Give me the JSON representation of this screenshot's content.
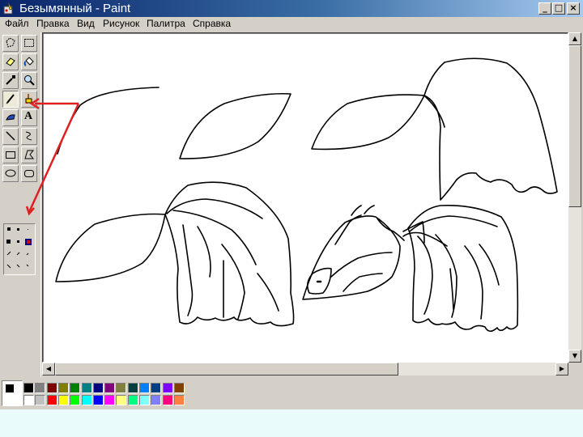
{
  "window": {
    "title": "Безымянный - Paint",
    "controls": {
      "minimize": "_",
      "maximize": "□",
      "close": "×"
    }
  },
  "menu": [
    "Файл",
    "Правка",
    "Вид",
    "Рисунок",
    "Палитра",
    "Справка"
  ],
  "toolbox": {
    "tools": [
      {
        "name": "free-select",
        "icon": "free-select-icon"
      },
      {
        "name": "rect-select",
        "icon": "rect-select-icon"
      },
      {
        "name": "eraser",
        "icon": "eraser-icon"
      },
      {
        "name": "fill",
        "icon": "paint-bucket-icon"
      },
      {
        "name": "pick-color",
        "icon": "eyedropper-icon"
      },
      {
        "name": "magnifier",
        "icon": "magnifier-icon"
      },
      {
        "name": "pencil",
        "icon": "pencil-icon",
        "selected": true
      },
      {
        "name": "brush",
        "icon": "brush-icon"
      },
      {
        "name": "airbrush",
        "icon": "airbrush-icon"
      },
      {
        "name": "text",
        "icon": "text-icon",
        "glyph": "A"
      },
      {
        "name": "line",
        "icon": "line-icon"
      },
      {
        "name": "curve",
        "icon": "curve-icon"
      },
      {
        "name": "rectangle",
        "icon": "rectangle-icon"
      },
      {
        "name": "polygon",
        "icon": "polygon-icon"
      },
      {
        "name": "ellipse",
        "icon": "ellipse-icon"
      },
      {
        "name": "rounded-rectangle",
        "icon": "rounded-rectangle-icon"
      }
    ]
  },
  "palette": {
    "primary": "#000000",
    "secondary": "#ffffff",
    "row1": [
      "#000000",
      "#808080",
      "#800000",
      "#808000",
      "#008000",
      "#008080",
      "#000080",
      "#800080",
      "#808040",
      "#004040",
      "#0080ff",
      "#004080",
      "#8000ff",
      "#804000"
    ],
    "row2": [
      "#ffffff",
      "#c0c0c0",
      "#ff0000",
      "#ffff00",
      "#00ff00",
      "#00ffff",
      "#0000ff",
      "#ff00ff",
      "#ffff80",
      "#00ff80",
      "#80ffff",
      "#8080ff",
      "#ff0080",
      "#ff8040"
    ]
  },
  "colors": {
    "titlebar": "#0a246a",
    "face": "#d4d0c8",
    "annotation": "#e02020"
  }
}
